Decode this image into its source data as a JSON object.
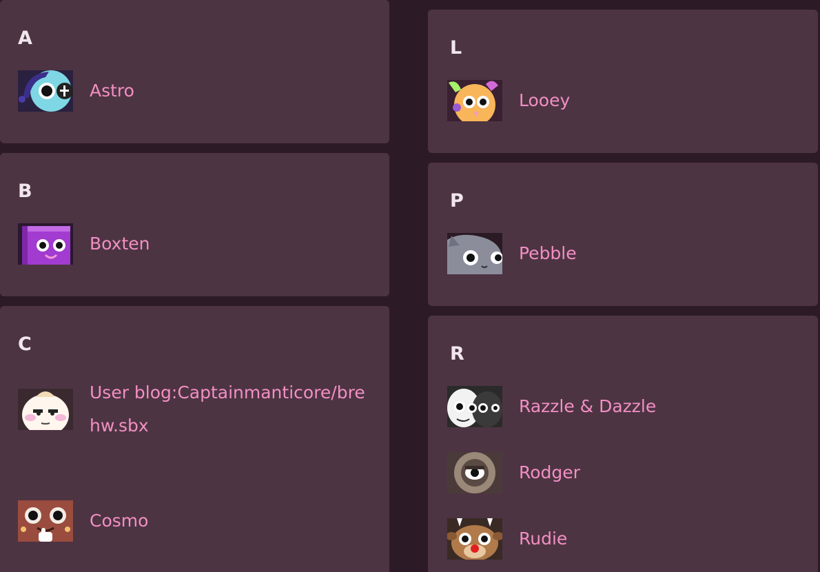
{
  "colors": {
    "page_background": "#2c1a26",
    "card_background": "#4d3443",
    "letter_text": "#f1e6ee",
    "link_text": "#f28fc3"
  },
  "groups": {
    "a": {
      "letter": "A",
      "entries": [
        {
          "name": "Astro",
          "icon": "astro-thumbnail"
        }
      ]
    },
    "b": {
      "letter": "B",
      "entries": [
        {
          "name": "Boxten",
          "icon": "boxten-thumbnail"
        }
      ]
    },
    "c": {
      "letter": "C",
      "entries": [
        {
          "name": "User blog:Captainmanticore/brehw.sbx",
          "icon": "brehw-thumbnail"
        },
        {
          "name": "Cosmo",
          "icon": "cosmo-thumbnail"
        }
      ]
    },
    "l": {
      "letter": "L",
      "entries": [
        {
          "name": "Looey",
          "icon": "looey-thumbnail"
        }
      ]
    },
    "p": {
      "letter": "P",
      "entries": [
        {
          "name": "Pebble",
          "icon": "pebble-thumbnail"
        }
      ]
    },
    "r": {
      "letter": "R",
      "entries": [
        {
          "name": "Razzle & Dazzle",
          "icon": "razzle-dazzle-thumbnail"
        },
        {
          "name": "Rodger",
          "icon": "rodger-thumbnail"
        },
        {
          "name": "Rudie",
          "icon": "rudie-thumbnail"
        }
      ]
    }
  }
}
